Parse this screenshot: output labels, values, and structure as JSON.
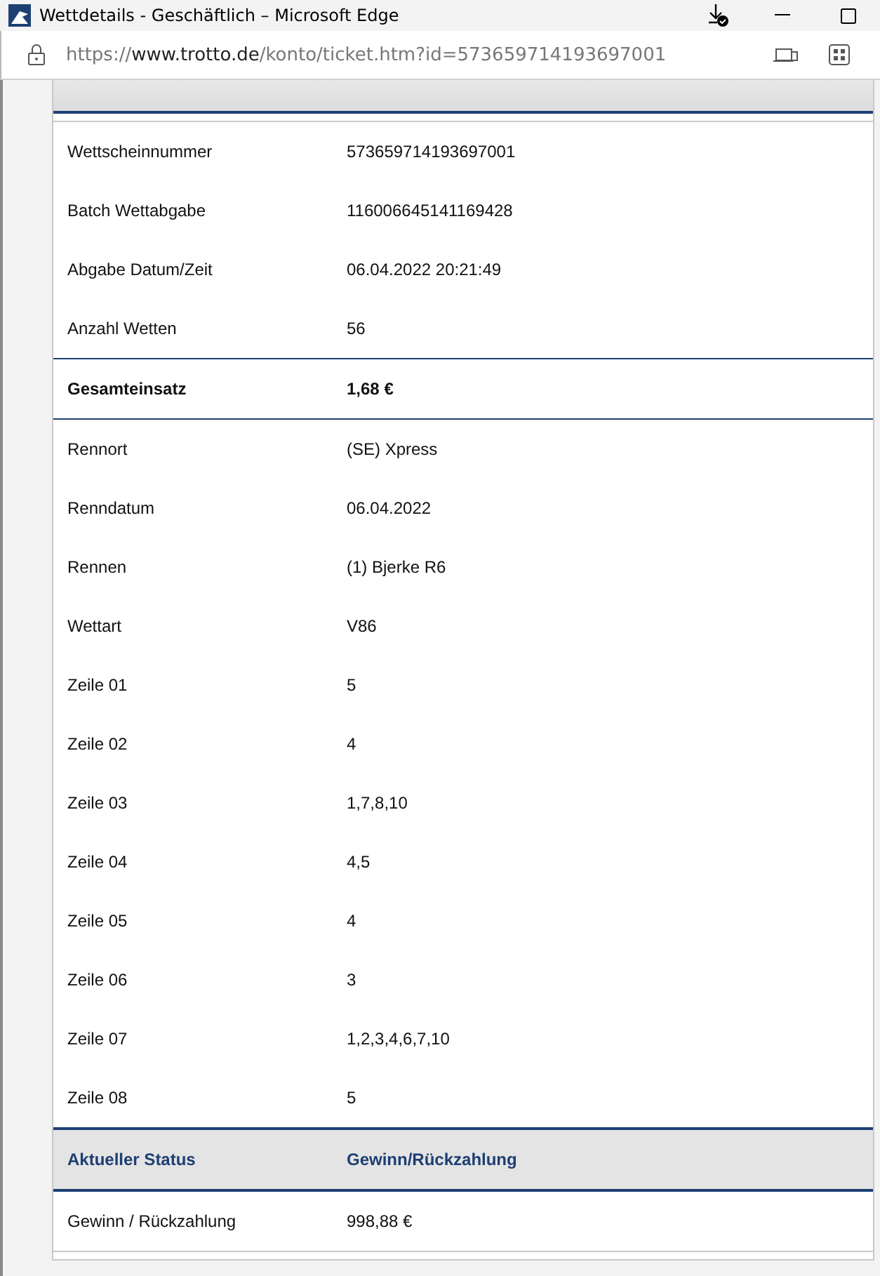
{
  "window": {
    "title": "Wettdetails - Geschäftlich – Microsoft Edge"
  },
  "address_bar": {
    "scheme": "https://",
    "host": "www.trotto.de",
    "path": "/konto/ticket.htm?id=573659714193697001"
  },
  "ticket": {
    "rows": [
      {
        "kind": "plain",
        "label": "Wettscheinnummer",
        "value": "573659714193697001"
      },
      {
        "kind": "plain",
        "label": "Batch Wettabgabe",
        "value": "116006645141169428"
      },
      {
        "kind": "plain",
        "label": "Abgabe Datum/Zeit",
        "value": "06.04.2022 20:21:49"
      },
      {
        "kind": "plain",
        "label": "Anzahl Wetten",
        "value": "56"
      },
      {
        "kind": "total",
        "label": "Gesamteinsatz",
        "value": "1,68 €"
      },
      {
        "kind": "plain",
        "label": "Rennort",
        "value": "(SE) Xpress"
      },
      {
        "kind": "plain",
        "label": "Renndatum",
        "value": "06.04.2022"
      },
      {
        "kind": "plain",
        "label": "Rennen",
        "value": "(1) Bjerke R6"
      },
      {
        "kind": "plain",
        "label": "Wettart",
        "value": "V86"
      },
      {
        "kind": "plain",
        "label": "Zeile 01",
        "value": "5"
      },
      {
        "kind": "plain",
        "label": "Zeile 02",
        "value": "4"
      },
      {
        "kind": "plain",
        "label": "Zeile 03",
        "value": "1,7,8,10"
      },
      {
        "kind": "plain",
        "label": "Zeile 04",
        "value": "4,5"
      },
      {
        "kind": "plain",
        "label": "Zeile 05",
        "value": "4"
      },
      {
        "kind": "plain",
        "label": "Zeile 06",
        "value": "3"
      },
      {
        "kind": "plain",
        "label": "Zeile 07",
        "value": "1,2,3,4,6,7,10"
      },
      {
        "kind": "plain",
        "label": "Zeile 08",
        "value": "5"
      },
      {
        "kind": "status",
        "label": "Aktueller Status",
        "value": "Gewinn/Rückzahlung"
      },
      {
        "kind": "plain",
        "label": "Gewinn / Rückzahlung",
        "value": "998,88 €"
      }
    ]
  }
}
